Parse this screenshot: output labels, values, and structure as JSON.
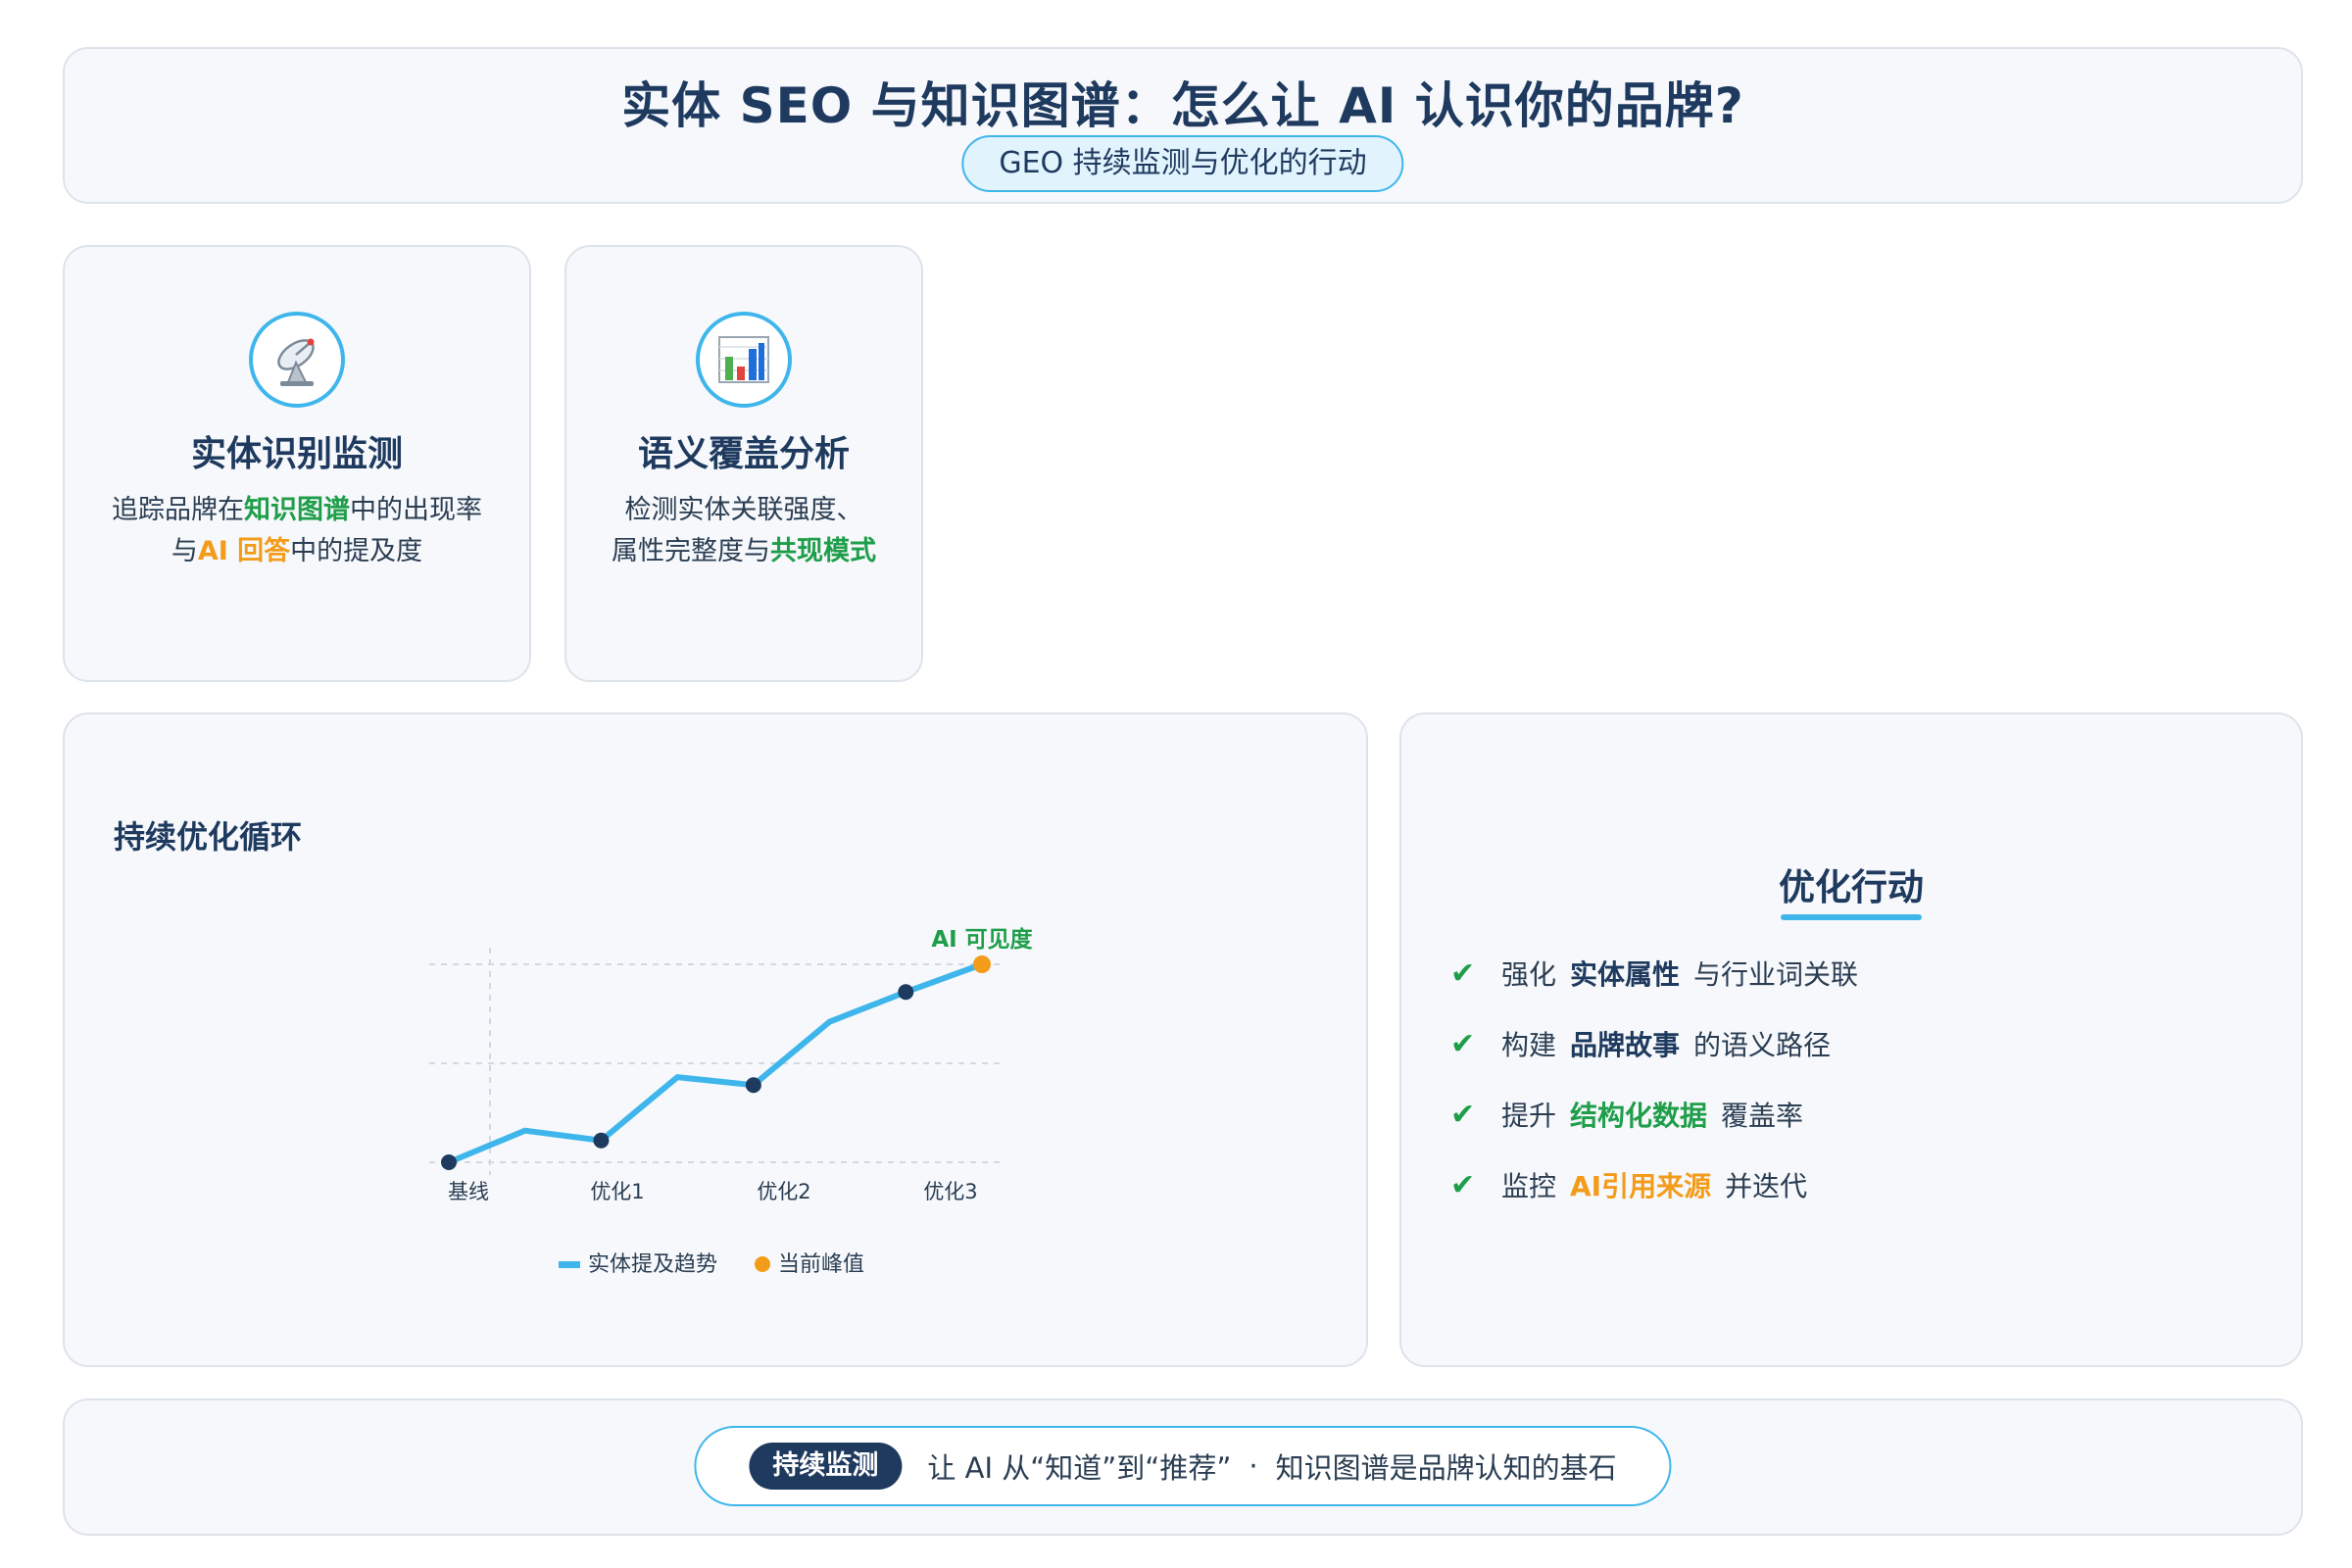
{
  "header": {
    "title": "实体 SEO 与知识图谱：怎么让 AI 认识你的品牌?",
    "subtitle": "GEO 持续监测与优化的行动"
  },
  "cards": [
    {
      "icon": "satellite-dish-icon",
      "title": "实体识别监测",
      "desc_part1": "追踪品牌在",
      "desc_hl1": "知识图谱",
      "desc_part2": "中的出现率",
      "desc_part3": "与",
      "desc_hl2": "AI 回答",
      "desc_part4": "中的提及度"
    },
    {
      "icon": "bar-chart-icon",
      "title": "语义覆盖分析",
      "desc_part1": "检测实体关联强度、",
      "desc_part2": "属性完整度与",
      "desc_hl1": "共现模式"
    }
  ],
  "chart_panel": {
    "title": "持续优化循环"
  },
  "chart_data": {
    "type": "line",
    "title": "持续优化循环",
    "tick_labels": [
      "基线",
      "优化1",
      "优化2",
      "优化3"
    ],
    "x": [
      0,
      1,
      2,
      3,
      4,
      5,
      6,
      7
    ],
    "series": [
      {
        "name": "实体提及趋势",
        "values": [
          0.0,
          0.16,
          0.11,
          0.43,
          0.39,
          0.71,
          0.86,
          1.0
        ],
        "color": "#3fb6eb"
      }
    ],
    "marked_points": [
      0,
      2,
      4,
      6
    ],
    "peak": {
      "name": "当前峰值",
      "index": 7,
      "label": "AI 可见度",
      "color": "#f39c1a"
    },
    "grid": true,
    "legend_position": "bottom-center"
  },
  "actions": {
    "title": "优化行动",
    "items": [
      {
        "prefix": "强化",
        "keyword": "实体属性",
        "suffix": "与行业词关联",
        "kw_color": "navy"
      },
      {
        "prefix": "构建",
        "keyword": "品牌故事",
        "suffix": "的语义路径",
        "kw_color": "navy"
      },
      {
        "prefix": "提升",
        "keyword": "结构化数据",
        "suffix": "覆盖率",
        "kw_color": "green"
      },
      {
        "prefix": "监控",
        "keyword": "AI引用来源",
        "suffix": "并迭代",
        "kw_color": "orange"
      }
    ],
    "check_glyph": "✔"
  },
  "footer": {
    "badge": "持续监测",
    "text": "让 AI 从“知道”到“推荐”",
    "separator": "·",
    "note": "知识图谱是品牌认知的基石"
  },
  "colors": {
    "navy": "#1f3a5f",
    "accent_blue": "#3fb6eb",
    "green": "#1f9e4a",
    "orange": "#f39c1a"
  }
}
